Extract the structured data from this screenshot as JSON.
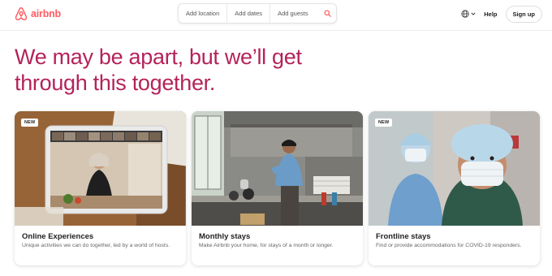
{
  "brand": {
    "name": "airbnb",
    "color": "#ff5a5f"
  },
  "search": {
    "location_label": "Add location",
    "dates_label": "Add dates",
    "guests_label": "Add guests",
    "icon": "search-icon"
  },
  "nav": {
    "language_icon": "globe-icon",
    "help_label": "Help",
    "signup_label": "Sign up"
  },
  "hero": {
    "line1": "We may be apart, but we’ll get",
    "line2": "through this together.",
    "color": "#b4235a"
  },
  "cards": [
    {
      "badge": "NEW",
      "title": "Online Experiences",
      "description": "Unique activities we can do together, led by a world of hosts."
    },
    {
      "title": "Monthly stays",
      "description": "Make Airbnb your home, for stays of a month or longer."
    },
    {
      "badge": "NEW",
      "title": "Frontline stays",
      "description": "Find or provide accommodations for COVID-19 responders."
    }
  ]
}
